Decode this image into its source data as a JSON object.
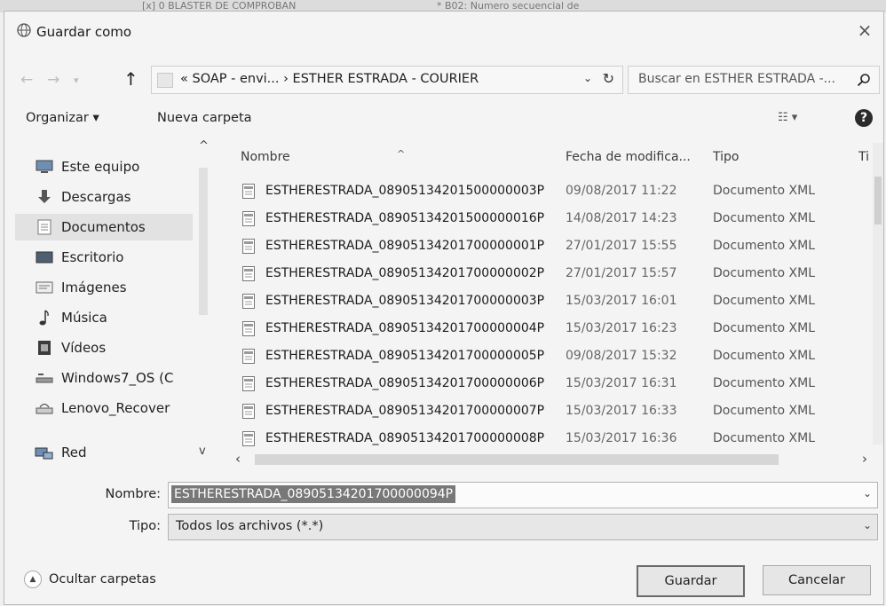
{
  "background": {
    "fragment_1": "[x] 0 BLASTER DE COMPROBAN",
    "fragment_2": "* B02: Numero secuencial de"
  },
  "dialog": {
    "title": "Guardar como",
    "close_glyph": "×"
  },
  "nav": {
    "up_glyph": "↑",
    "address_prefix": "«",
    "address_segment_1": "SOAP - envi...",
    "address_separator": "›",
    "address_segment_2": "ESTHER ESTRADA - COURIER",
    "refresh_glyph": "↻",
    "search_placeholder": "Buscar en ESTHER ESTRADA -..."
  },
  "toolbar": {
    "organize_label": "Organizar",
    "organize_caret": "▾",
    "new_folder_label": "Nueva carpeta",
    "view_glyph": "☷ ▾",
    "help_glyph": "?"
  },
  "sidebar": {
    "items": [
      {
        "label": "Este equipo",
        "icon": "computer-icon"
      },
      {
        "label": "Descargas",
        "icon": "download-icon"
      },
      {
        "label": "Documentos",
        "icon": "documents-icon",
        "selected": true
      },
      {
        "label": "Escritorio",
        "icon": "desktop-icon"
      },
      {
        "label": "Imágenes",
        "icon": "pictures-icon"
      },
      {
        "label": "Música",
        "icon": "music-icon"
      },
      {
        "label": "Vídeos",
        "icon": "videos-icon"
      },
      {
        "label": "Windows7_OS (C",
        "icon": "drive-icon"
      },
      {
        "label": "Lenovo_Recover",
        "icon": "recovery-drive-icon"
      },
      {
        "label": "Red",
        "icon": "network-icon"
      }
    ],
    "scroll_up_glyph": "^",
    "scroll_down_glyph": "v"
  },
  "file_list": {
    "columns": [
      "Nombre",
      "Fecha de modifica...",
      "Tipo",
      "Ti"
    ],
    "sort_glyph": "^",
    "rows": [
      {
        "name": "ESTHERESTRADA_08905134201500000003P",
        "date": "09/08/2017 11:22",
        "type": "Documento XML"
      },
      {
        "name": "ESTHERESTRADA_08905134201500000016P",
        "date": "14/08/2017 14:23",
        "type": "Documento XML"
      },
      {
        "name": "ESTHERESTRADA_08905134201700000001P",
        "date": "27/01/2017 15:55",
        "type": "Documento XML"
      },
      {
        "name": "ESTHERESTRADA_08905134201700000002P",
        "date": "27/01/2017 15:57",
        "type": "Documento XML"
      },
      {
        "name": "ESTHERESTRADA_08905134201700000003P",
        "date": "15/03/2017 16:01",
        "type": "Documento XML"
      },
      {
        "name": "ESTHERESTRADA_08905134201700000004P",
        "date": "15/03/2017 16:23",
        "type": "Documento XML"
      },
      {
        "name": "ESTHERESTRADA_08905134201700000005P",
        "date": "09/08/2017 15:32",
        "type": "Documento XML"
      },
      {
        "name": "ESTHERESTRADA_08905134201700000006P",
        "date": "15/03/2017 16:31",
        "type": "Documento XML"
      },
      {
        "name": "ESTHERESTRADA_08905134201700000007P",
        "date": "15/03/2017 16:33",
        "type": "Documento XML"
      },
      {
        "name": "ESTHERESTRADA_08905134201700000008P",
        "date": "15/03/2017 16:36",
        "type": "Documento XML"
      }
    ],
    "hscroll_left_glyph": "‹",
    "hscroll_right_glyph": "›"
  },
  "form": {
    "filename_label": "Nombre:",
    "filename_value": "ESTHERESTRADA_08905134201700000094P",
    "type_label": "Tipo:",
    "type_value": "Todos los archivos (*.*)",
    "dropdown_glyph": "⌄"
  },
  "footer": {
    "hide_folders_label": "Ocultar carpetas",
    "hide_folders_glyph": "▲",
    "save_label": "Guardar",
    "cancel_label": "Cancelar"
  },
  "colors": {
    "dialog_bg": "#f4f4f4",
    "selection_bg": "#787878",
    "selected_nav_bg": "#e2e2e2"
  }
}
